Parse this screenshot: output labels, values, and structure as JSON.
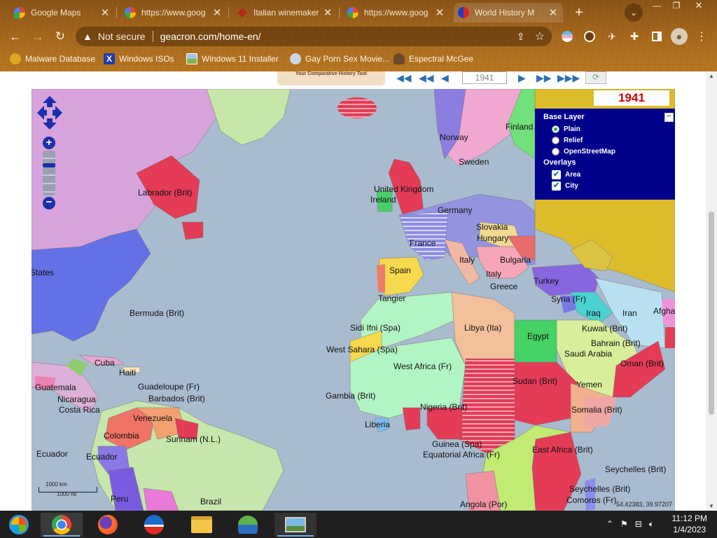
{
  "browser": {
    "tabs": [
      {
        "title": "Google Maps",
        "favicon_color": "#34a853"
      },
      {
        "title": "https://www.goog",
        "favicon_color": "#ffffff"
      },
      {
        "title": "Italian winemaker",
        "favicon_color": "#b3261e"
      },
      {
        "title": "https://www.goog",
        "favicon_color": "#ffffff"
      },
      {
        "title": "World History M",
        "favicon_color": "#1a3cc8"
      }
    ],
    "new_tab_icon": "plus-icon",
    "address": {
      "security_label": "Not secure",
      "url": "geacron.com/home-en/"
    },
    "bookmarks": [
      {
        "label": "Malware Database",
        "icon_color": "#e0a526"
      },
      {
        "label": "Windows ISOs",
        "icon_color": "#1c3fa8"
      },
      {
        "label": "Windows 11 Installer",
        "icon_color": "#7fb04a"
      },
      {
        "label": "Gay Porn Sex Movie...",
        "icon_color": "#ccd6e6"
      },
      {
        "label": "Espectral McGee",
        "icon_color": "#6b4a2a"
      }
    ]
  },
  "geacron": {
    "tagline": "Your Comparative History Tool",
    "year_input": "1941",
    "current_year": "1941",
    "layer_panel": {
      "base_title": "Base Layer",
      "base_options": [
        {
          "label": "Plain",
          "selected": true
        },
        {
          "label": "Relief",
          "selected": false
        },
        {
          "label": "OpenStreetMap",
          "selected": false
        }
      ],
      "overlays_title": "Overlays",
      "overlays": [
        {
          "label": "Area",
          "checked": true
        },
        {
          "label": "City",
          "checked": true
        }
      ]
    },
    "scale": {
      "km": "1000 km",
      "mi": "1000 mi"
    },
    "coordinates": "54.42383, 39.97207",
    "labels": [
      "Norway",
      "Sweden",
      "Finland",
      "United Kingdom",
      "Ireland",
      "Germany",
      "Slovakia",
      "Hungary",
      "France",
      "Italy",
      "Bulgaria",
      "Spain",
      "Italy",
      "Greece",
      "Turkey",
      "Tangier",
      "Syria (Fr)",
      "Iraq",
      "Iran",
      "Afgha",
      "Labrador (Brit)",
      "States",
      "Bermuda (Brit)",
      "Cuba",
      "Haiti",
      "Guadeloupe (Fr)",
      "Barbados (Brit)",
      "Guatemala",
      "Nicaragua",
      "Costa Rica",
      "Venezuela",
      "Colombia",
      "Surinam (N.L.)",
      "Ecuador",
      "Ecuador",
      "Peru",
      "Brazil",
      "Sidi Ifni (Spa)",
      "West Sahara (Spa)",
      "West Africa (Fr)",
      "Libya (Ita)",
      "Egypt",
      "Kuwait (Brit)",
      "Bahrain (Brit)",
      "Saudi Arabia",
      "Oman (Brit)",
      "Yemen",
      "Sudan (Brit)",
      "Somalia (Brit)",
      "Gambia (Brit)",
      "Nigeria (Brit)",
      "Liberia",
      "Guinea (Spa)",
      "Equatorial Africa (Fr)",
      "East Africa (Brit)",
      "Seychelles (Brit)",
      "Seychelles (Brit)",
      "Comoros (Fr)",
      "Angola (Por)"
    ]
  },
  "taskbar": {
    "apps": [
      "start",
      "chrome",
      "firefox",
      "opera",
      "file-explorer",
      "network-tool",
      "photos"
    ],
    "time": "11:12 PM",
    "date": "1/4/2023"
  }
}
